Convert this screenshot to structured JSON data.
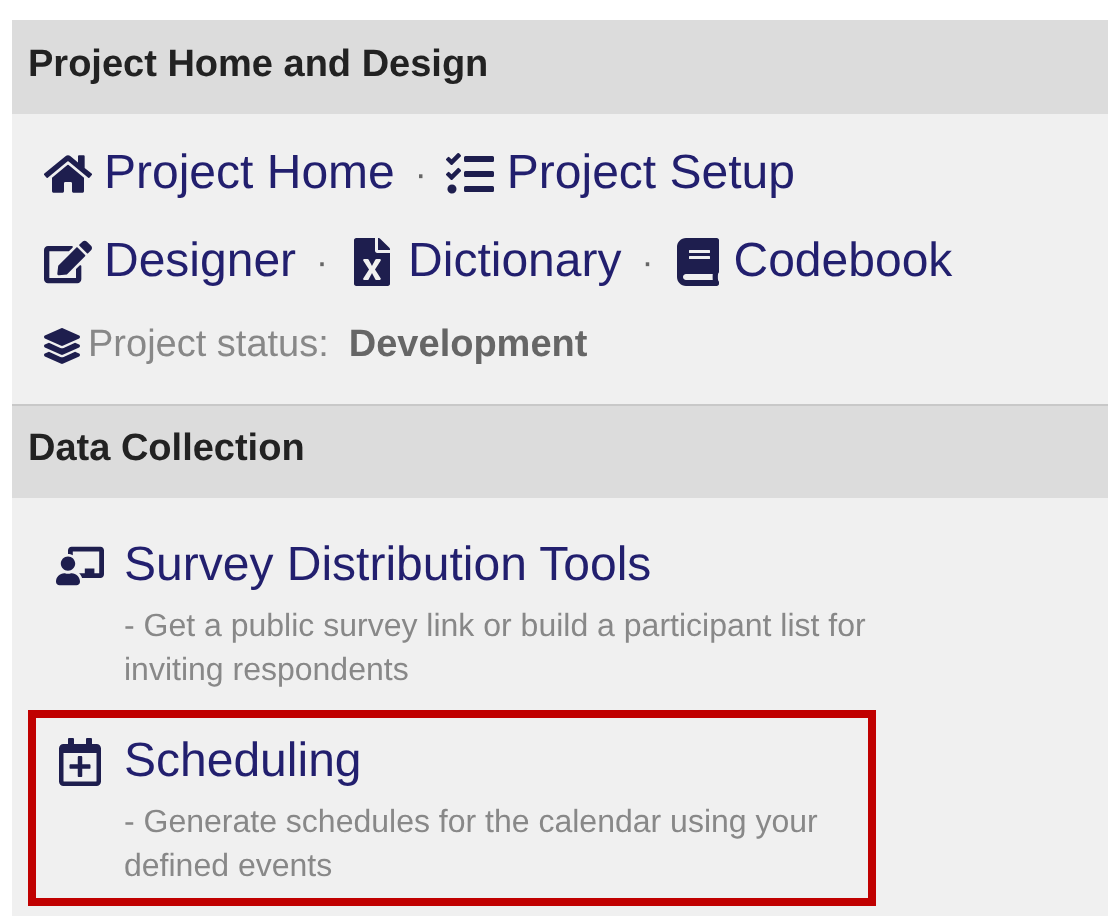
{
  "sections": [
    {
      "title": "Project Home and Design",
      "link_rows": [
        [
          {
            "label": "Project Home",
            "kind": "home"
          },
          {
            "label": "Project Setup",
            "kind": "setup"
          }
        ],
        [
          {
            "label": "Designer",
            "kind": "designer"
          },
          {
            "label": "Dictionary",
            "kind": "dictionary"
          },
          {
            "label": "Codebook",
            "kind": "codebook"
          }
        ]
      ],
      "separator": "·",
      "status": {
        "label": "Project status:",
        "value": "Development"
      }
    },
    {
      "title": "Data Collection",
      "items": [
        {
          "label": "Survey Distribution Tools",
          "kind": "distribution",
          "description": "- Get a public survey link or build a participant list for inviting respondents",
          "highlighted": false
        },
        {
          "label": "Scheduling",
          "kind": "scheduling",
          "description": "- Generate schedules for the calendar using your defined events",
          "highlighted": true
        }
      ]
    }
  ]
}
